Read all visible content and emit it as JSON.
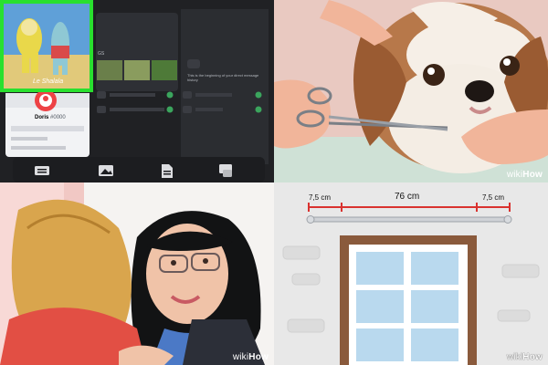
{
  "panels": {
    "discord": {
      "sticker_caption": "Le Shalala",
      "profile_name": "Doris",
      "profile_tag": "#0000",
      "channel_tag": "GS",
      "message_hint": "This is the beginning of your direct message history",
      "toolbar_icons": [
        "keyboard-icon",
        "image-icon",
        "document-icon",
        "sticker-icon"
      ]
    },
    "dog_trim": {
      "watermark_wiki": "wiki",
      "watermark_how": "How"
    },
    "doctor": {
      "watermark_wiki": "wiki",
      "watermark_how": "How"
    },
    "curtain_rod": {
      "left_margin": "7,5 cm",
      "total_width": "76 cm",
      "right_margin": "7,5 cm",
      "watermark_wiki": "wiki",
      "watermark_how": "How"
    }
  },
  "colors": {
    "highlight_green": "#29e02f",
    "discord_bg": "#202124",
    "measure_red": "#d9322f"
  }
}
